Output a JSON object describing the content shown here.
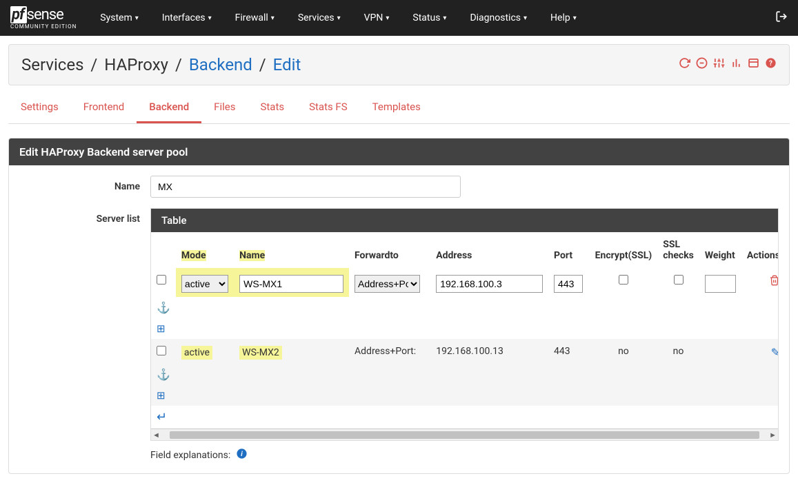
{
  "logo": {
    "pf": "pf",
    "sense": "sense",
    "sub": "COMMUNITY EDITION"
  },
  "nav": [
    "System",
    "Interfaces",
    "Firewall",
    "Services",
    "VPN",
    "Status",
    "Diagnostics",
    "Help"
  ],
  "breadcrumb": {
    "a": "Services",
    "b": "HAProxy",
    "c": "Backend",
    "d": "Edit"
  },
  "tabs": [
    "Settings",
    "Frontend",
    "Backend",
    "Files",
    "Stats",
    "Stats FS",
    "Templates"
  ],
  "active_tab": "Backend",
  "panel_title": "Edit HAProxy Backend server pool",
  "labels": {
    "name": "Name",
    "server_list": "Server list",
    "field_exp": "Field explanations:"
  },
  "form": {
    "name_value": "MX"
  },
  "table": {
    "title": "Table",
    "headers": {
      "mode": "Mode",
      "name": "Name",
      "forwardto": "Forwardto",
      "address": "Address",
      "port": "Port",
      "encrypt": "Encrypt(SSL)",
      "sslchecks": "SSL checks",
      "weight": "Weight",
      "actions": "Actions"
    },
    "rows": [
      {
        "mode": "active",
        "name": "WS-MX1",
        "forwardto": "Address+Port:",
        "address": "192.168.100.3",
        "port": "443",
        "encrypt": false,
        "sslchecks": false,
        "weight": "",
        "editable": true
      },
      {
        "mode": "active",
        "name": "WS-MX2",
        "forwardto": "Address+Port:",
        "address": "192.168.100.13",
        "port": "443",
        "encrypt_text": "no",
        "sslchecks_text": "no",
        "weight": "",
        "editable": false
      }
    ]
  }
}
